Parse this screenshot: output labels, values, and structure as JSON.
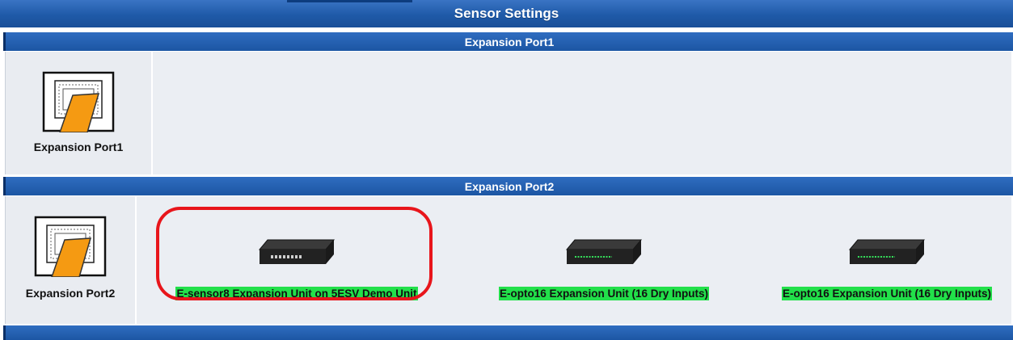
{
  "header": {
    "title": "Sensor Settings"
  },
  "sections": [
    {
      "title": "Expansion Port1",
      "port_label": "Expansion Port1",
      "port_icon": "expansion-port-icon",
      "units": []
    },
    {
      "title": "Expansion Port2",
      "port_label": "Expansion Port2",
      "port_icon": "expansion-port-icon",
      "units": [
        {
          "label": "E-sensor8 Expansion Unit on 5ESV Demo Unit",
          "icon": "expansion-unit-icon",
          "highlighted": true
        },
        {
          "label": "E-opto16 Expansion Unit (16 Dry Inputs)",
          "icon": "expansion-unit-icon",
          "highlighted": false
        },
        {
          "label": "E-opto16 Expansion Unit (16 Dry Inputs)",
          "icon": "expansion-unit-icon",
          "highlighted": false
        }
      ]
    }
  ],
  "colors": {
    "header_blue": "#1f5aa8",
    "label_green": "#22e04a",
    "highlight_red": "#e8151b",
    "port_orange": "#f59a12"
  }
}
